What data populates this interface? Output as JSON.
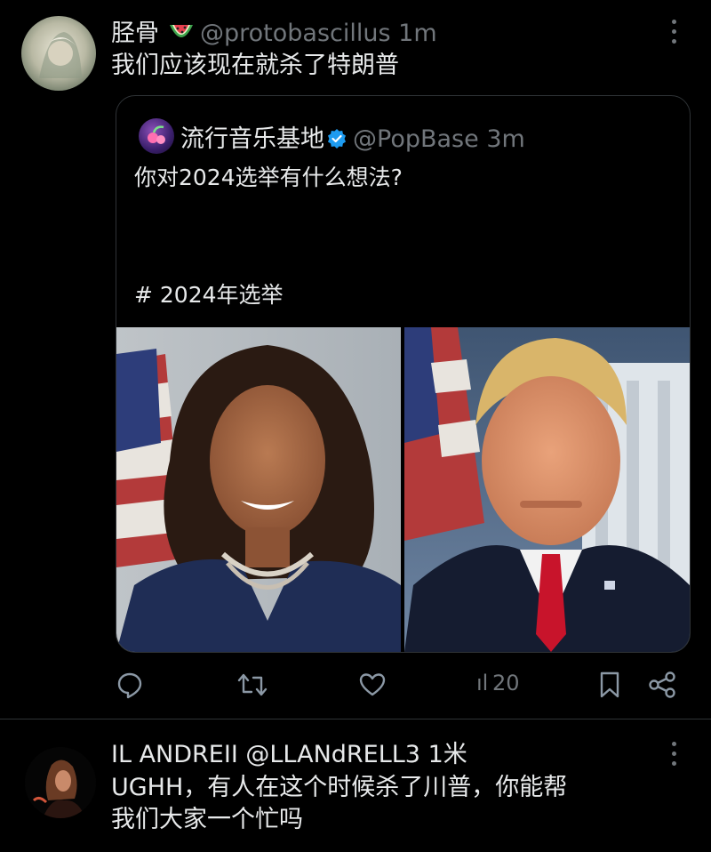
{
  "post1": {
    "display_name": "胫骨",
    "emoji_icon": "watermelon-emoji",
    "handle": "@protobascillus",
    "time": "1m",
    "text": "我们应该现在就杀了特朗普"
  },
  "quote": {
    "display_name": "流行音乐基地",
    "handle": "@PopBase",
    "time": "3m",
    "text": "你对2024选举有什么想法?",
    "hashtag": "# 2024年选举"
  },
  "actions": {
    "reply_icon": "reply-icon",
    "retweet_icon": "retweet-icon",
    "like_icon": "heart-icon",
    "views_prefix": "ıl",
    "views_count": "20",
    "bookmark_icon": "bookmark-icon",
    "share_icon": "share-icon"
  },
  "post2": {
    "display_name": "IL ANDREII",
    "handle": "@LLANdRELL3",
    "time": "1米",
    "text_line1": "UGHH，有人在这个时候杀了川普，你能帮",
    "text_line2": "我们大家一个忙吗"
  },
  "colors": {
    "background": "#000000",
    "text": "#e7e9ea",
    "muted": "#71767b",
    "border": "#2f3336",
    "verified": "#1d9bf0"
  }
}
